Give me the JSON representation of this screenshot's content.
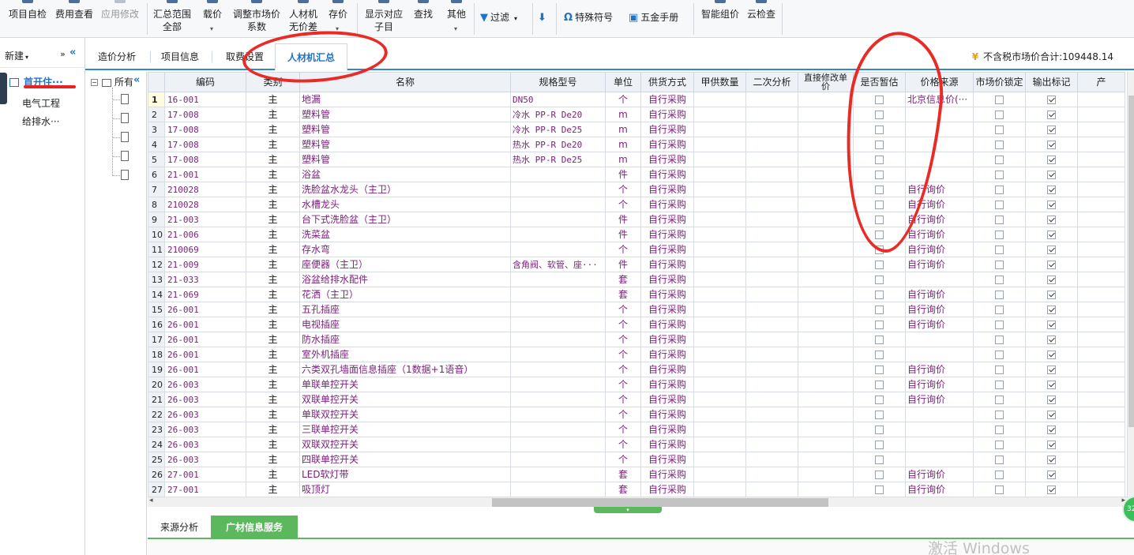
{
  "toolbar": {
    "items": [
      {
        "l1": "项目自检",
        "l2": ""
      },
      {
        "l1": "费用查看",
        "l2": ""
      },
      {
        "l1": "应用修改",
        "l2": ""
      },
      {
        "l1": "汇总范围",
        "l2": "全部"
      },
      {
        "l1": "载价",
        "l2": ""
      },
      {
        "l1": "调整市场价",
        "l2": "系数"
      },
      {
        "l1": "人材机",
        "l2": "无价差"
      },
      {
        "l1": "存价",
        "l2": ""
      },
      {
        "l1": "显示对应",
        "l2": "子目"
      },
      {
        "l1": "查找",
        "l2": ""
      },
      {
        "l1": "其他",
        "l2": ""
      },
      {
        "l1": "智能组价",
        "l2": ""
      },
      {
        "l1": "云检查",
        "l2": ""
      }
    ],
    "filter_label": "过滤",
    "special_symbol_label": "特殊符号",
    "hardware_manual_label": "五金手册"
  },
  "leftnav": {
    "new_label": "新建",
    "more_label": "»",
    "items": [
      "首开住···",
      "电气工程",
      "给排水···"
    ]
  },
  "tabs": [
    "造价分析",
    "项目信息",
    "取费设置",
    "人材机汇总"
  ],
  "total_label": "不含税市场价合计:109448.14",
  "tree": {
    "root_label": "所有"
  },
  "grid": {
    "columns": [
      "编码",
      "类别",
      "名称",
      "规格型号",
      "单位",
      "供货方式",
      "甲供数量",
      "二次分析",
      "直接修改单价",
      "是否暂估",
      "价格来源",
      "市场价锁定",
      "输出标记",
      "产"
    ],
    "rows": [
      [
        "1",
        "16-001",
        "主",
        "地漏",
        "DN50",
        "个",
        "自行采购",
        "",
        "",
        "",
        false,
        "北京信息价(···",
        false,
        true
      ],
      [
        "2",
        "17-008",
        "主",
        "塑料管",
        "冷水 PP-R De20",
        "m",
        "自行采购",
        "",
        "",
        "",
        false,
        "",
        false,
        true
      ],
      [
        "3",
        "17-008",
        "主",
        "塑料管",
        "冷水 PP-R De25",
        "m",
        "自行采购",
        "",
        "",
        "",
        false,
        "",
        false,
        true
      ],
      [
        "4",
        "17-008",
        "主",
        "塑料管",
        "热水 PP-R De20",
        "m",
        "自行采购",
        "",
        "",
        "",
        false,
        "",
        false,
        true
      ],
      [
        "5",
        "17-008",
        "主",
        "塑料管",
        "热水 PP-R De25",
        "m",
        "自行采购",
        "",
        "",
        "",
        false,
        "",
        false,
        true
      ],
      [
        "6",
        "21-001",
        "主",
        "浴盆",
        "",
        "件",
        "自行采购",
        "",
        "",
        "",
        false,
        "",
        false,
        true
      ],
      [
        "7",
        "210028",
        "主",
        "洗脸盆水龙头（主卫）",
        "",
        "个",
        "自行采购",
        "",
        "",
        "",
        false,
        "自行询价",
        false,
        true
      ],
      [
        "8",
        "210028",
        "主",
        "水槽龙头",
        "",
        "个",
        "自行采购",
        "",
        "",
        "",
        false,
        "自行询价",
        false,
        true
      ],
      [
        "9",
        "21-003",
        "主",
        "台下式洗脸盆（主卫）",
        "",
        "件",
        "自行采购",
        "",
        "",
        "",
        false,
        "自行询价",
        false,
        true
      ],
      [
        "10",
        "21-006",
        "主",
        "洗菜盆",
        "",
        "件",
        "自行采购",
        "",
        "",
        "",
        false,
        "自行询价",
        false,
        true
      ],
      [
        "11",
        "210069",
        "主",
        "存水弯",
        "",
        "个",
        "自行采购",
        "",
        "",
        "",
        false,
        "自行询价",
        false,
        true
      ],
      [
        "12",
        "21-009",
        "主",
        "座便器（主卫）",
        "含角阀、软管、座···",
        "件",
        "自行采购",
        "",
        "",
        "",
        false,
        "自行询价",
        false,
        true
      ],
      [
        "13",
        "21-033",
        "主",
        "浴盆给排水配件",
        "",
        "套",
        "自行采购",
        "",
        "",
        "",
        false,
        "",
        false,
        true
      ],
      [
        "14",
        "21-069",
        "主",
        "花洒（主卫）",
        "",
        "套",
        "自行采购",
        "",
        "",
        "",
        false,
        "自行询价",
        false,
        true
      ],
      [
        "15",
        "26-001",
        "主",
        "五孔插座",
        "",
        "个",
        "自行采购",
        "",
        "",
        "",
        false,
        "自行询价",
        false,
        true
      ],
      [
        "16",
        "26-001",
        "主",
        "电视插座",
        "",
        "个",
        "自行采购",
        "",
        "",
        "",
        false,
        "自行询价",
        false,
        true
      ],
      [
        "17",
        "26-001",
        "主",
        "防水插座",
        "",
        "个",
        "自行采购",
        "",
        "",
        "",
        false,
        "",
        false,
        true
      ],
      [
        "18",
        "26-001",
        "主",
        "室外机插座",
        "",
        "个",
        "自行采购",
        "",
        "",
        "",
        false,
        "",
        false,
        true
      ],
      [
        "19",
        "26-001",
        "主",
        "六类双孔墙面信息插座（1数据+1语音）",
        "",
        "个",
        "自行采购",
        "",
        "",
        "",
        false,
        "自行询价",
        false,
        true
      ],
      [
        "20",
        "26-003",
        "主",
        "单联单控开关",
        "",
        "个",
        "自行采购",
        "",
        "",
        "",
        false,
        "自行询价",
        false,
        true
      ],
      [
        "21",
        "26-003",
        "主",
        "双联单控开关",
        "",
        "个",
        "自行采购",
        "",
        "",
        "",
        false,
        "自行询价",
        false,
        true
      ],
      [
        "22",
        "26-003",
        "主",
        "单联双控开关",
        "",
        "个",
        "自行采购",
        "",
        "",
        "",
        false,
        "",
        false,
        true
      ],
      [
        "23",
        "26-003",
        "主",
        "三联单控开关",
        "",
        "个",
        "自行采购",
        "",
        "",
        "",
        false,
        "",
        false,
        true
      ],
      [
        "24",
        "26-003",
        "主",
        "双联双控开关",
        "",
        "个",
        "自行采购",
        "",
        "",
        "",
        false,
        "",
        false,
        true
      ],
      [
        "25",
        "26-003",
        "主",
        "四联单控开关",
        "",
        "个",
        "自行采购",
        "",
        "",
        "",
        false,
        "",
        false,
        true
      ],
      [
        "26",
        "27-001",
        "主",
        "LED软灯带",
        "",
        "套",
        "自行采购",
        "",
        "",
        "",
        false,
        "自行询价",
        false,
        true
      ],
      [
        "27",
        "27-001",
        "主",
        "吸顶灯",
        "",
        "套",
        "自行采购",
        "",
        "",
        "",
        false,
        "自行询价",
        false,
        true
      ]
    ]
  },
  "bottom_tabs": [
    "来源分析",
    "广材信息服务"
  ],
  "watermark": "激活 Windows",
  "badge": "32",
  "colors": {
    "accent": "#1f73c9",
    "bottom_accent": "#5cb85c",
    "annotation": "#ea2a25",
    "cell_text": "#7a1f7a"
  }
}
